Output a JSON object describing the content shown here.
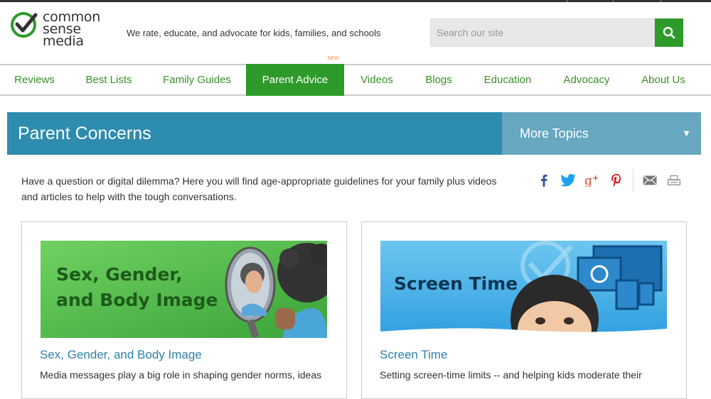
{
  "brand": {
    "logo_lines": [
      "common",
      "sense",
      "media"
    ],
    "tagline": "We rate, educate, and advocate for kids, families, and schools",
    "accent": "#2e9a2a"
  },
  "search": {
    "placeholder": "Search our site",
    "value": ""
  },
  "nav": {
    "items": [
      {
        "label": "Reviews"
      },
      {
        "label": "Best Lists"
      },
      {
        "label": "Family Guides"
      },
      {
        "label": "Parent Advice",
        "badge": "NEW",
        "active": true
      },
      {
        "label": "Videos"
      },
      {
        "label": "Blogs"
      },
      {
        "label": "Education"
      },
      {
        "label": "Advocacy"
      },
      {
        "label": "About Us"
      }
    ]
  },
  "banner": {
    "title": "Parent Concerns",
    "more_topics": "More Topics",
    "caret": "▼",
    "color": "#2e8cae"
  },
  "intro": {
    "text": "Have a question or digital dilemma? Here you will find age-appropriate guidelines for your family plus videos and articles to help with the tough conversations."
  },
  "share": {
    "icons": [
      "facebook-icon",
      "twitter-icon",
      "google-plus-icon",
      "pinterest-icon",
      "email-icon",
      "print-icon"
    ]
  },
  "cards": [
    {
      "image_text_line1": "Sex, Gender,",
      "image_text_line2": "and Body Image",
      "title": "Sex, Gender, and Body Image",
      "desc": "Media messages play a big role in shaping gender norms, ideas"
    },
    {
      "image_text_line1": "Screen Time",
      "title": "Screen Time",
      "desc": "Setting screen-time limits -- and helping kids moderate their"
    }
  ]
}
